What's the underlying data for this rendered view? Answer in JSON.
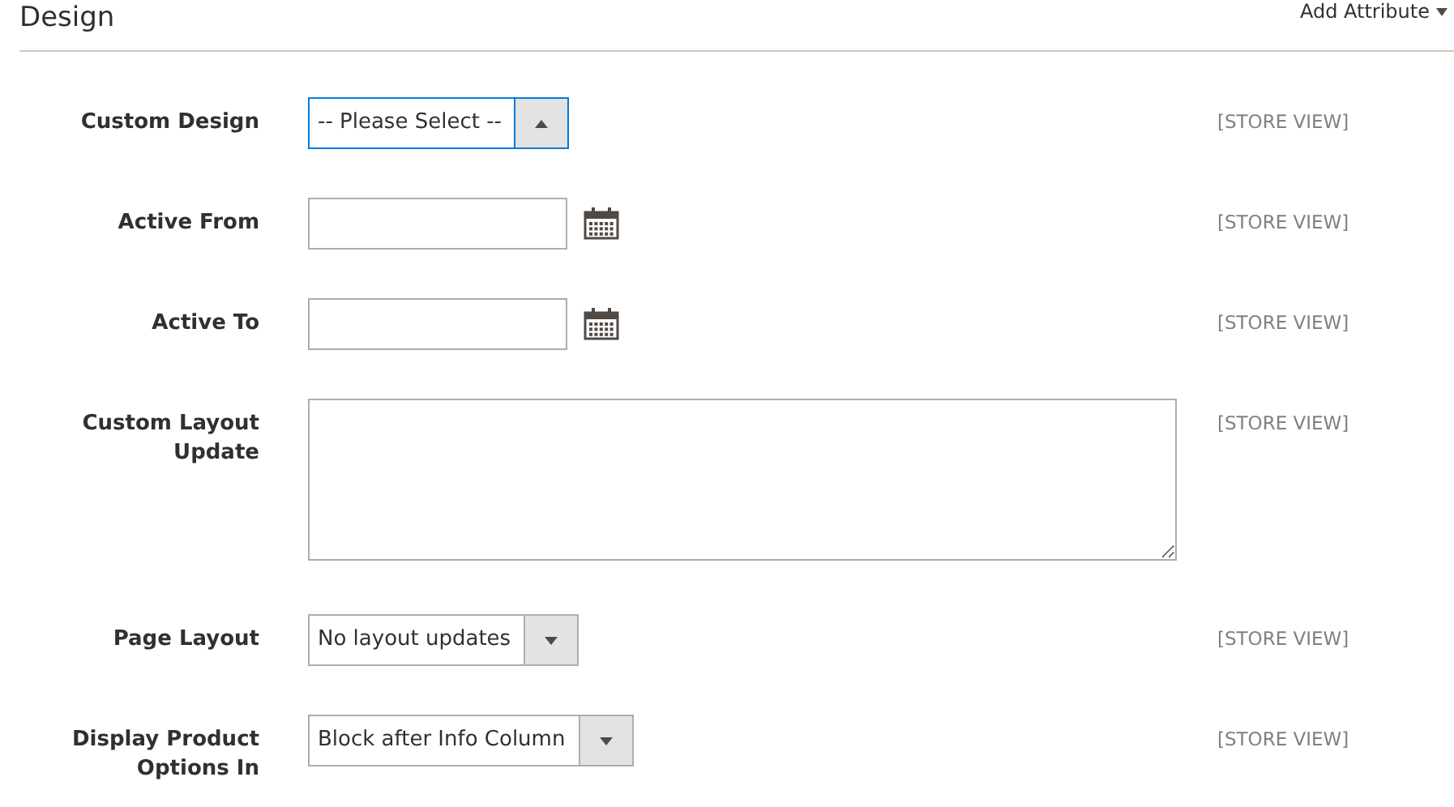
{
  "section": {
    "title": "Design",
    "add_attribute": "Add Attribute"
  },
  "fields": [
    {
      "kind": "select",
      "label": "Custom Design",
      "value": "-- Please Select --",
      "expanded": true,
      "scope": "[STORE VIEW]"
    },
    {
      "kind": "date",
      "label": "Active From",
      "scope": "[STORE VIEW]"
    },
    {
      "kind": "date",
      "label": "Active To",
      "scope": "[STORE VIEW]"
    },
    {
      "kind": "textarea",
      "label": "Custom Layout Update",
      "scope": "[STORE VIEW]"
    },
    {
      "kind": "select",
      "label": "Page Layout",
      "value": "No layout updates",
      "expanded": false,
      "scope": "[STORE VIEW]"
    },
    {
      "kind": "select",
      "label": "Display Product Options In",
      "value": "Block after Info Column",
      "expanded": false,
      "scope": "[STORE VIEW]"
    }
  ]
}
